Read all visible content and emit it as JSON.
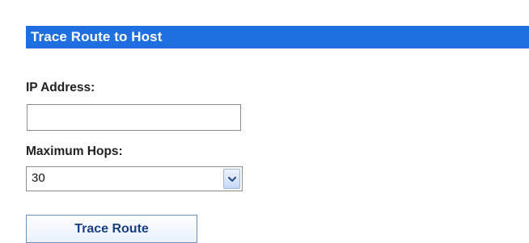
{
  "form": {
    "title": "Trace Route to Host",
    "ip_address_label": "IP Address:",
    "ip_address_value": "",
    "max_hops_label": "Maximum Hops:",
    "max_hops_selected": "30",
    "submit_label": "Trace Route"
  },
  "icons": {
    "select_arrow": "chevron-down-icon"
  },
  "colors": {
    "header_bg": "#1f6fe0",
    "header_text": "#ffffff",
    "button_text": "#163f86"
  }
}
